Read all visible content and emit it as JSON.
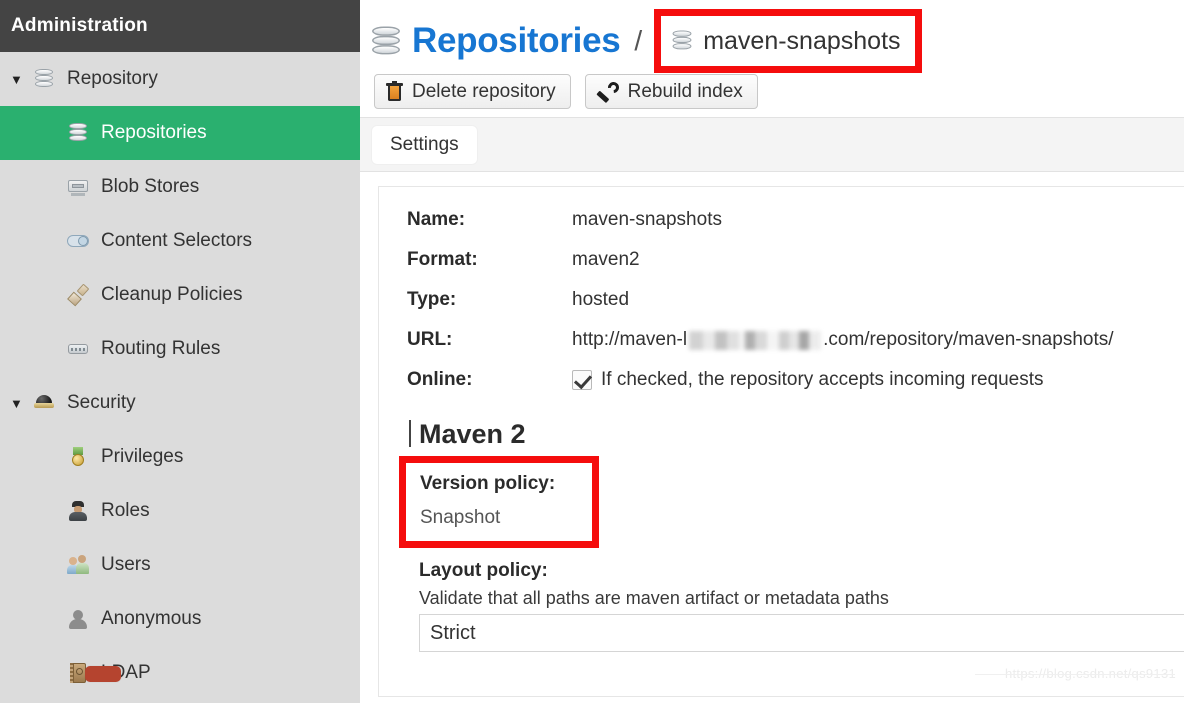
{
  "sidebar": {
    "header_title": "Administration",
    "groups": [
      {
        "label": "Repository",
        "icon": "database-icon",
        "caret": "▼",
        "items": [
          {
            "label": "Repositories",
            "icon": "database-icon",
            "active": true
          },
          {
            "label": "Blob Stores",
            "icon": "blob-store-icon",
            "active": false
          },
          {
            "label": "Content Selectors",
            "icon": "toggle-icon",
            "active": false
          },
          {
            "label": "Cleanup Policies",
            "icon": "brush-icon",
            "active": false
          },
          {
            "label": "Routing Rules",
            "icon": "router-icon",
            "active": false
          }
        ]
      },
      {
        "label": "Security",
        "icon": "alarm-bell-icon",
        "caret": "▼",
        "items": [
          {
            "label": "Privileges",
            "icon": "medal-icon",
            "active": false
          },
          {
            "label": "Roles",
            "icon": "officer-icon",
            "active": false
          },
          {
            "label": "Users",
            "icon": "users-icon",
            "active": false
          },
          {
            "label": "Anonymous",
            "icon": "anonymous-user-icon",
            "active": false
          },
          {
            "label": "LDAP",
            "icon": "address-book-icon",
            "active": false
          }
        ]
      }
    ]
  },
  "header": {
    "title": "Repositories",
    "separator": "/",
    "breadcrumb_current": "maven-snapshots",
    "title_icon": "database-icon",
    "breadcrumb_icon": "database-icon",
    "highlight_color": "#f50d0d"
  },
  "toolbar": {
    "delete_label": "Delete repository",
    "delete_icon": "trash-icon",
    "rebuild_label": "Rebuild index",
    "rebuild_icon": "wrench-icon"
  },
  "tabs": [
    {
      "label": "Settings",
      "active": true
    }
  ],
  "settings": {
    "fields": [
      {
        "label": "Name:",
        "value": "maven-snapshots"
      },
      {
        "label": "Format:",
        "value": "maven2"
      },
      {
        "label": "Type:",
        "value": "hosted"
      }
    ],
    "url": {
      "label": "URL:",
      "prefix": "http://maven-l",
      "redacted": true,
      "suffix": ".com/repository/maven-snapshots/"
    },
    "online": {
      "label": "Online:",
      "checked": true,
      "description": "If checked, the repository accepts incoming requests"
    }
  },
  "maven_section": {
    "title": "Maven 2",
    "version_policy": {
      "label": "Version policy:",
      "value": "Snapshot",
      "highlighted": true
    },
    "layout_policy": {
      "label": "Layout policy:",
      "help": "Validate that all paths are maven artifact or metadata paths",
      "value": "Strict"
    }
  },
  "watermark": "https://blog.csdn.net/qs9131",
  "colors": {
    "sidebar_bg": "#dcdcdc",
    "sidebar_header_bg": "#444444",
    "active_green": "#2ab06f",
    "title_blue": "#1776d2",
    "highlight_red": "#f50d0d"
  }
}
